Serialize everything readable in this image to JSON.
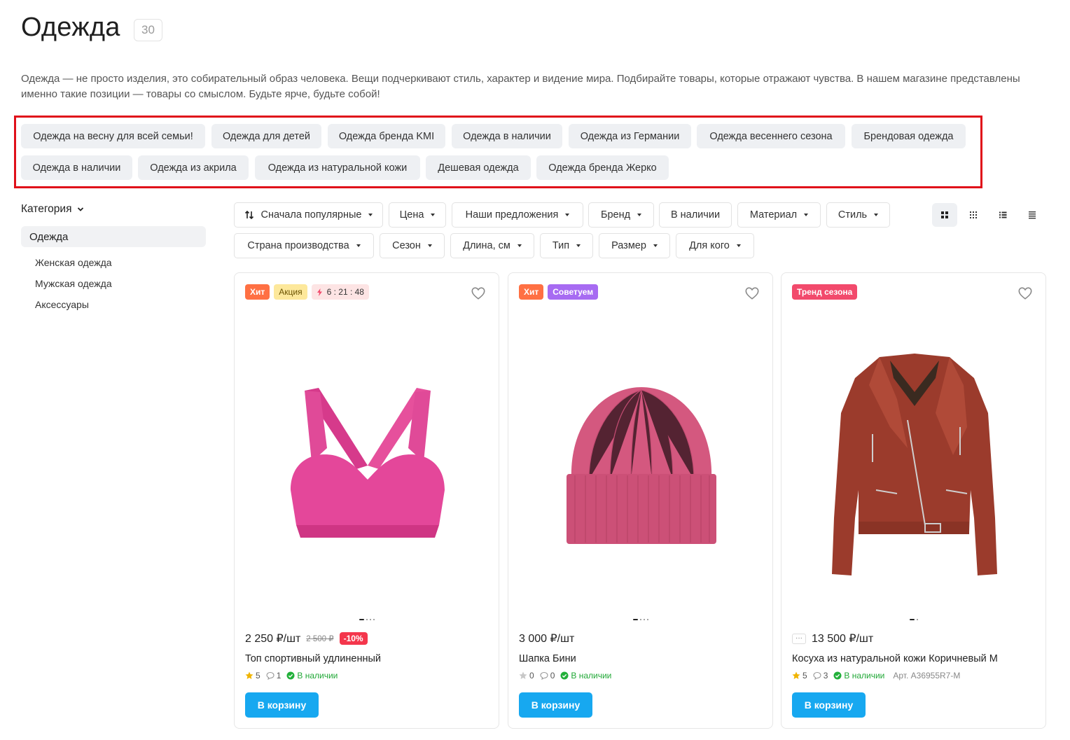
{
  "header": {
    "title": "Одежда",
    "count": "30"
  },
  "description": "Одежда — не просто изделия, это собирательный образ человека. Вещи подчеркивают стиль, характер и видение мира. Подбирайте товары, которые отражают чувства. В нашем магазине представлены именно такие позиции — товары со смыслом. Будьте ярче, будьте собой!",
  "tags": [
    "Одежда на весну для всей семьи!",
    "Одежда для детей",
    "Одежда бренда KMI",
    "Одежда в наличии",
    "Одежда из Германии",
    "Одежда весеннего сезона",
    "Брендовая одежда",
    "Одежда в наличии",
    "Одежда из акрила",
    "Одежда из натуральной кожи",
    "Дешевая одежда",
    "Одежда бренда Жерко"
  ],
  "sidebar": {
    "header": "Категория",
    "active": "Одежда",
    "items": [
      "Женская одежда",
      "Мужская одежда",
      "Аксессуары"
    ]
  },
  "filters": [
    "Сначала популярные",
    "Цена",
    "Наши предложения",
    "Бренд",
    "В наличии",
    "Материал",
    "Стиль",
    "Страна производства",
    "Сезон",
    "Длина, см",
    "Тип",
    "Размер",
    "Для кого"
  ],
  "view_modes": [
    "grid-large-icon",
    "grid-small-icon",
    "list-icon",
    "compact-list-icon"
  ],
  "products": [
    {
      "badges": {
        "hit": "Хит",
        "promo": "Акция",
        "timer": "6 : 21 : 48"
      },
      "price": "2 250 ₽/шт",
      "old_price": "2 500 ₽",
      "discount": "-10%",
      "name": "Топ спортивный удлиненный",
      "rating": "5",
      "reviews": "1",
      "stock": "В наличии",
      "cart": "В корзину",
      "color": "#e0479a"
    },
    {
      "badges": {
        "hit": "Хит",
        "recommend": "Советуем"
      },
      "price": "3 000 ₽/шт",
      "name": "Шапка Бини",
      "rating": "0",
      "reviews": "0",
      "stock": "В наличии",
      "cart": "В корзину",
      "color": "#d45a7f"
    },
    {
      "badges": {
        "trend": "Тренд сезона"
      },
      "more": "···",
      "price": "13 500 ₽/шт",
      "name": "Косуха из натуральной кожи Коричневый M",
      "rating": "5",
      "reviews": "3",
      "stock": "В наличии",
      "article": "Арт. A36955R7-M",
      "cart": "В корзину",
      "color": "#9b3b2c"
    }
  ]
}
